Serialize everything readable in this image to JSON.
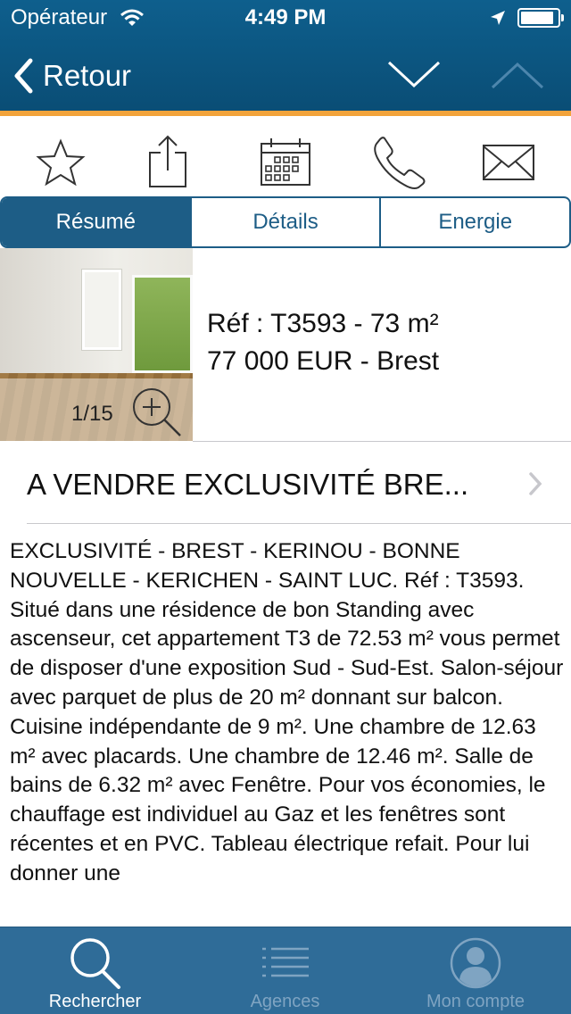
{
  "status_bar": {
    "carrier": "Opérateur",
    "time": "4:49 PM",
    "battery_level": 0.9
  },
  "nav": {
    "back_label": "Retour"
  },
  "actions": [
    {
      "icon": "star-icon"
    },
    {
      "icon": "share-icon"
    },
    {
      "icon": "calendar-icon"
    },
    {
      "icon": "phone-icon"
    },
    {
      "icon": "mail-icon"
    }
  ],
  "tabs": [
    {
      "label": "Résumé",
      "active": true
    },
    {
      "label": "Détails",
      "active": false
    },
    {
      "label": "Energie",
      "active": false
    }
  ],
  "listing": {
    "photo_counter": "1/15",
    "ref_line": "Réf : T3593 - 73 m²",
    "price_line": "77 000 EUR - Brest",
    "title": "A VENDRE EXCLUSIVITÉ BRE...",
    "description": "EXCLUSIVITÉ - BREST - KERINOU - BONNE NOUVELLE - KERICHEN - SAINT LUC. Réf : T3593. Situé dans une résidence de bon Standing avec ascenseur, cet appartement T3 de 72.53 m² vous permet de disposer d'une exposition Sud - Sud-Est. Salon-séjour avec parquet de plus de 20 m² donnant sur balcon. Cuisine indépendante de 9 m². Une chambre de 12.63 m² avec placards. Une chambre de 12.46 m². Salle de bains de 6.32 m² avec Fenêtre. Pour vos économies, le chauffage est individuel au Gaz et les fenêtres sont récentes et en PVC. Tableau électrique refait. Pour lui donner une"
  },
  "tabbar": [
    {
      "label": "Rechercher",
      "icon": "search-icon",
      "active": true
    },
    {
      "label": "Agences",
      "icon": "list-icon",
      "active": false
    },
    {
      "label": "Mon compte",
      "icon": "user-icon",
      "active": false
    }
  ],
  "colors": {
    "nav_bg": "#0a4d75",
    "accent_orange": "#f2a33b",
    "segment_blue": "#1d5d86",
    "tabbar_bg": "#2f6c98",
    "tabbar_active": "#ffffff",
    "tabbar_inactive": "#7fa4c2"
  }
}
